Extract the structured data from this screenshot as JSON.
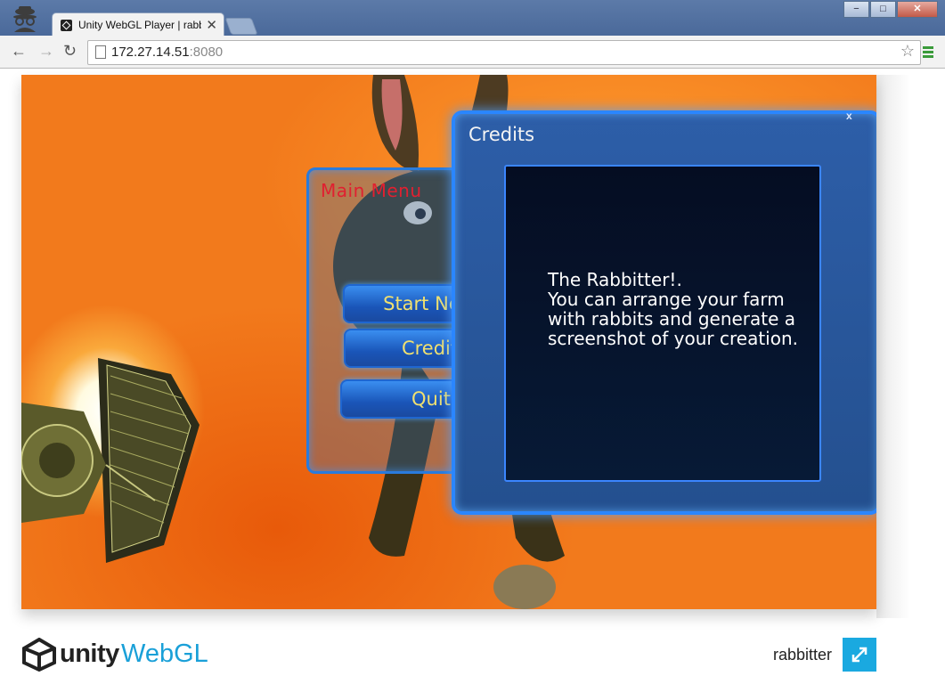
{
  "browser": {
    "tab_title": "Unity WebGL Player | rabbitter",
    "url_host": "172.27.14.51",
    "url_port": ":8080",
    "window_buttons": [
      "−",
      "□",
      "✕"
    ]
  },
  "game": {
    "main_menu": {
      "title": "Main Menu",
      "buttons": [
        "Start New",
        "Credits",
        "Quit"
      ]
    },
    "credits_dialog": {
      "title": "Credits",
      "close": "x",
      "body": "The Rabbitter!.\nYou can arrange your farm with rabbits and generate a screenshot of your creation."
    }
  },
  "footer": {
    "brand": "unity",
    "product": "WebGL",
    "game_title": "rabbitter"
  },
  "colors": {
    "titlebar": "#4a699a",
    "panel_border": "#2a86ff",
    "main_menu_title": "#e02030",
    "menu_button_text": "#f0e070",
    "webgl_blue": "#1aa0d8",
    "fullscreen_button": "#1aa9e0"
  },
  "icons": [
    "incognito-icon",
    "unity-favicon",
    "tab-close-icon",
    "back-icon",
    "forward-icon",
    "reload-icon",
    "page-icon",
    "star-icon",
    "menu-icon",
    "unity-logo-icon",
    "fullscreen-icon"
  ]
}
